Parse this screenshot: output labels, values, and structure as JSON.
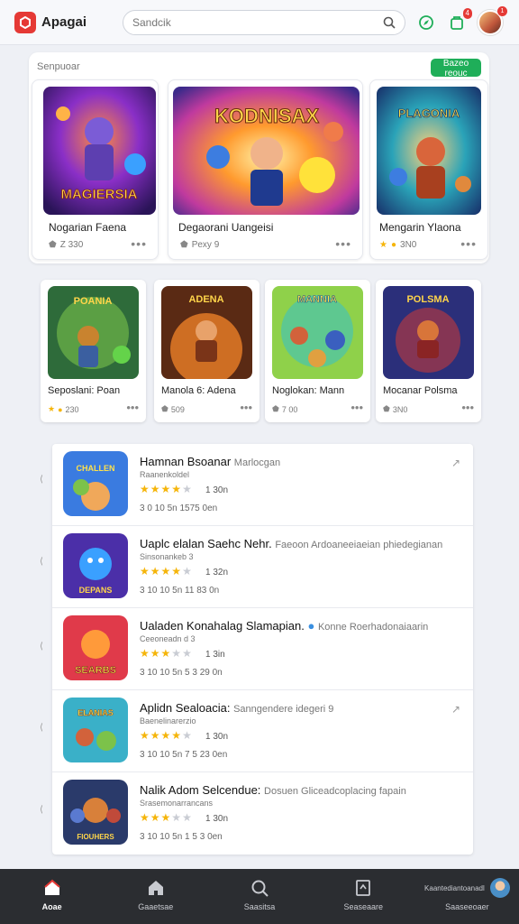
{
  "header": {
    "app_name": "Apagai",
    "search_placeholder": "Sandcik",
    "notification_count": "4",
    "avatar_badge": "1"
  },
  "featured": {
    "section_title": "Senpuoar",
    "button_label": "Bazeo reouc",
    "cards": [
      {
        "title": "Nogarian Faena",
        "meta_icon": "shield-icon",
        "meta": "Z 330",
        "art_text": "MAGIERSIA"
      },
      {
        "title": "Degaorani Uangeisi",
        "meta_icon": "shield-icon",
        "meta": "Pexy 9",
        "art_text": "KODNISAX"
      },
      {
        "title": "Mengarin Ylaona",
        "meta_icon": "star-icon",
        "meta": "3N0",
        "art_text": "PLAGONIA"
      }
    ]
  },
  "small_cards": [
    {
      "title": "Seposlani: Poan",
      "meta_icon": "star-icon",
      "meta": "230",
      "art_text": "POANIA"
    },
    {
      "title": "Manola 6: Adena",
      "meta_icon": "shield-icon",
      "meta": "509",
      "art_text": "ADENA"
    },
    {
      "title": "Noglokan: Mann",
      "meta_icon": "shield-icon",
      "meta": "7 00",
      "art_text": "MANNIA"
    },
    {
      "title": "Mocanar Polsma",
      "meta_icon": "shield-icon",
      "meta": "3N0",
      "art_text": "POLSMA"
    }
  ],
  "list": [
    {
      "name": "Hamnan Bsoanar",
      "sub": "Marlocgan",
      "dev": "Raanenkoldel",
      "stars": 4,
      "rating": "1 30n",
      "stats": "3 0  10 5n  1575 0en",
      "action": "↗",
      "art_text": "CHALLEN"
    },
    {
      "name": "Uaplc elalan Saehc Nehr.",
      "sub": "Faeoon Ardoaneeiaeian phiedegianan",
      "dev": "Sinsonankeb 3",
      "stars": 4,
      "rating": "1 32n",
      "stats": "3 10  10 5n  11 83 0n",
      "action": "",
      "art_text": "DEPANS"
    },
    {
      "name": "Ualaden Konahalag Slamapian.",
      "sub": "Konne Roerhadonaiaarin",
      "dev": "Ceeoneadn d 3",
      "stars": 3,
      "rating": "1 3in",
      "stats": "3 10  10 5n  5 3 29 0n",
      "action": "",
      "art_text": "SEARBS"
    },
    {
      "name": "Aplidn Sealoacia:",
      "sub": "Sanngendere idegeri 9",
      "dev": "Baenelinarerzio",
      "stars": 4,
      "rating": "1 30n",
      "stats": "3 10  10 5n  7 5 23 0en",
      "action": "↗",
      "art_text": "ELANIAS"
    },
    {
      "name": "Nalik Adom Selcendue:",
      "sub": "Dosuen Gliceadcoplacing fapain",
      "dev": "Srasemonarrancans",
      "stars": 3,
      "rating": "1 30n",
      "stats": "3 10  10 5n  1 5 3 0en",
      "action": "",
      "art_text": "FIOUHERS"
    }
  ],
  "bottom_nav": [
    {
      "label": "Aoae",
      "icon": "home-icon",
      "active": true
    },
    {
      "label": "Gaaetsae",
      "icon": "house-icon",
      "active": false
    },
    {
      "label": "Saasitsa",
      "icon": "search-icon",
      "active": false
    },
    {
      "label": "Seaseaare",
      "icon": "library-icon",
      "active": false
    },
    {
      "label": "Saaseeoaer",
      "top_text": "Kaantediantoanadl",
      "icon": "profile-avatar",
      "active": false
    }
  ],
  "colors": {
    "accent": "#1fae59",
    "logo": "#e53935",
    "star": "#f5b50a",
    "nav_bg": "#2b2d31"
  }
}
